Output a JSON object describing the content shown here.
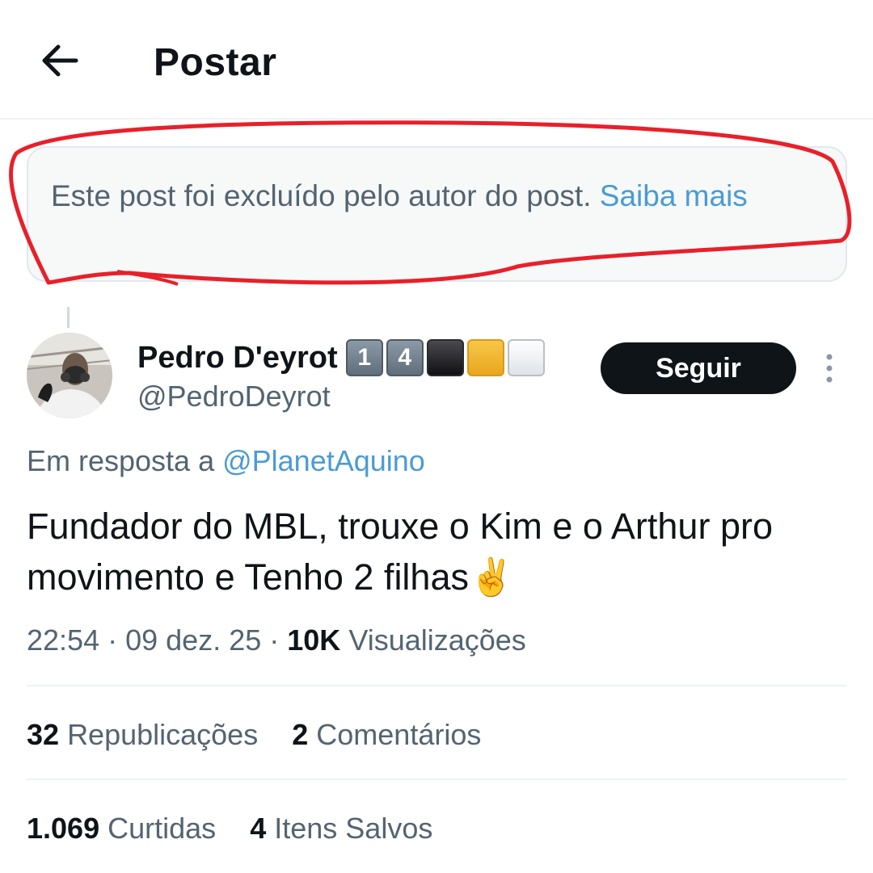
{
  "header": {
    "title": "Postar",
    "back_icon": "arrow-left-icon"
  },
  "deleted_notice": {
    "text": "Este post foi excluído pelo autor do post. ",
    "link": "Saiba mais",
    "annotation_color": "#e8202a"
  },
  "author": {
    "name": "Pedro D'eyrot",
    "badges": [
      "1",
      "4",
      "",
      "",
      ""
    ],
    "handle": "@PedroDeyrot",
    "follow_label": "Seguir"
  },
  "post": {
    "reply_prefix": "Em resposta a ",
    "reply_handle": "@PlanetAquino",
    "text": "Fundador do MBL, trouxe o Kim e o Arthur pro movimento e Tenho 2 filhas✌️",
    "time": "22:54",
    "date": "09 dez. 25",
    "views_count": "10K",
    "views_label": "Visualizações"
  },
  "stats": {
    "reposts_count": "32",
    "reposts_label": "Republicações",
    "comments_count": "2",
    "comments_label": "Comentários",
    "likes_count": "1.069",
    "likes_label": "Curtidas",
    "saves_count": "4",
    "saves_label": "Itens Salvos"
  },
  "colors": {
    "link": "#4a9bd4",
    "secondary_text": "#536471",
    "primary_text": "#0f1419"
  }
}
